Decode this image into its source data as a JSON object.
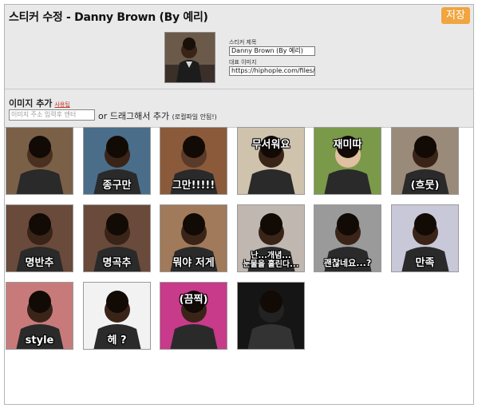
{
  "header": {
    "title": "스티커 수정 - Danny Brown (By 예리)",
    "save_label": "저장",
    "save_color": "#f0a53f"
  },
  "form": {
    "title_label": "스티커 제목",
    "title_value": "Danny Brown (By 예리)",
    "image_label": "대표 이미지",
    "image_value": "https://hiphople.com/files/at"
  },
  "add": {
    "heading": "이미지 추가",
    "usage_link": "사용팁",
    "url_placeholder": "이미지 주소 입력후 엔터",
    "or_text": "or 드래그해서 추가",
    "local_note": "(로컬파일 안됨!)"
  },
  "stickers": [
    {
      "caption": ""
    },
    {
      "caption": "종구만"
    },
    {
      "caption": "그만!!!!!"
    },
    {
      "caption": "무서워요"
    },
    {
      "caption": "재미따"
    },
    {
      "caption": "(흐뭇)"
    },
    {
      "caption": "명반추"
    },
    {
      "caption": "명곡추"
    },
    {
      "caption": "뭐야 저게"
    },
    {
      "caption": "난...개념...\n눈물을 흘린다..."
    },
    {
      "caption": "괜찮네요...?"
    },
    {
      "caption": "만족"
    },
    {
      "caption": "style"
    },
    {
      "caption": "헤 ? "
    },
    {
      "caption": "(끔찍)"
    },
    {
      "caption": ""
    }
  ]
}
